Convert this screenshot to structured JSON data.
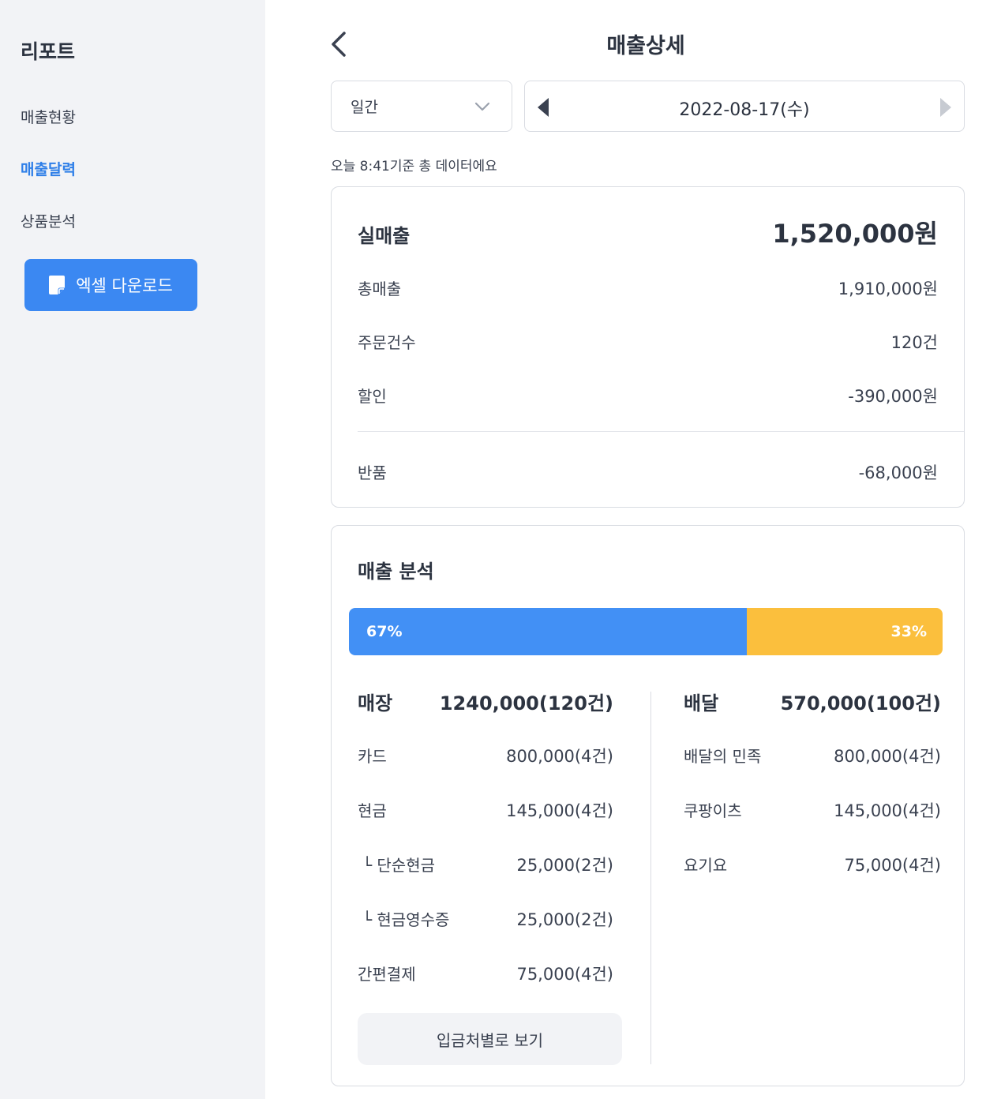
{
  "sidebar": {
    "title": "리포트",
    "items": [
      {
        "label": "매출현황",
        "active": false
      },
      {
        "label": "매출달력",
        "active": true
      },
      {
        "label": "상품분석",
        "active": false
      }
    ],
    "excel_button": {
      "label": "엑셀 다운로드",
      "icon": "document-icon"
    }
  },
  "header": {
    "title": "매출상세",
    "back_icon": "chevron-left-icon"
  },
  "filters": {
    "period": "일간",
    "date": "2022-08-17(수)"
  },
  "notice": "오늘 8:41기준 총 데이터에요",
  "summary": {
    "net_sales": {
      "label": "실매출",
      "value": "1,520,000원"
    },
    "rows": [
      {
        "label": "총매출",
        "value": "1,910,000원"
      },
      {
        "label": "주문건수",
        "value": "120건"
      },
      {
        "label": "할인",
        "value": "-390,000원"
      }
    ],
    "returns": {
      "label": "반품",
      "value": "-68,000원"
    }
  },
  "analysis": {
    "title": "매출 분석",
    "ratio": {
      "store_percent": 67,
      "delivery_percent": 33,
      "store_label": "67%",
      "delivery_label": "33%"
    },
    "store": {
      "label": "매장",
      "total": "1240,000(120건)",
      "rows": [
        {
          "label": "카드",
          "value": "800,000(4건)"
        },
        {
          "label": "현금",
          "value": "145,000(4건)"
        },
        {
          "label": "└ 단순현금",
          "value": "25,000(2건)"
        },
        {
          "label": "└ 현금영수증",
          "value": "25,000(2건)"
        },
        {
          "label": "간편결제",
          "value": "75,000(4건)"
        }
      ]
    },
    "delivery": {
      "label": "배달",
      "total": "570,000(100건)",
      "rows": [
        {
          "label": "배달의 민족",
          "value": "800,000(4건)"
        },
        {
          "label": "쿠팡이츠",
          "value": "145,000(4건)"
        },
        {
          "label": "요기요",
          "value": "75,000(4건)"
        }
      ]
    },
    "deposit_button": "입금처별로 보기"
  },
  "colors": {
    "accent": "#3b88f2",
    "store_bar": "#4290f5",
    "delivery_bar": "#fbbf3d",
    "active_nav": "#2f7fe8"
  }
}
